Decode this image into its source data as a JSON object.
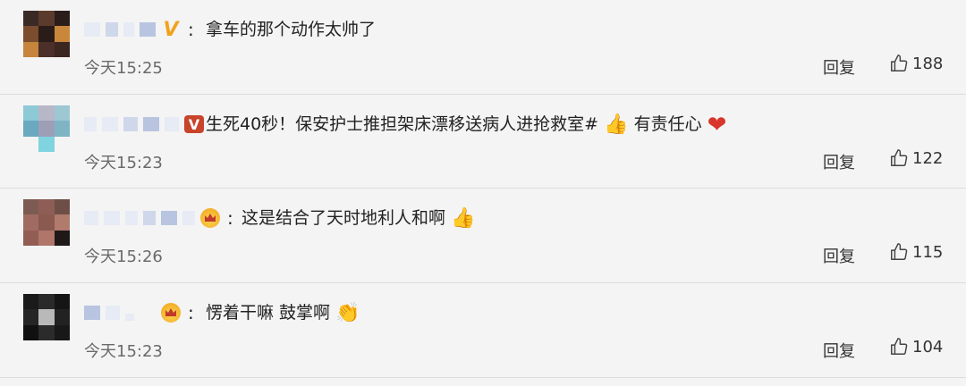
{
  "comments": [
    {
      "text_before": "拿车的那个动作太帅了",
      "text_after": "",
      "time": "今天15:25",
      "reply_label": "回复",
      "likes": "188"
    },
    {
      "text_before": "生死40秒！保安护士推担架床漂移送病人进抢救室#",
      "text_after": "有责任心",
      "time": "今天15:23",
      "reply_label": "回复",
      "likes": "122"
    },
    {
      "text_before": "这是结合了天时地利人和啊",
      "text_after": "",
      "time": "今天15:26",
      "reply_label": "回复",
      "likes": "115"
    },
    {
      "text_before": "愣着干嘛 鼓掌啊",
      "text_after": "",
      "time": "今天15:23",
      "reply_label": "回复",
      "likes": "104"
    }
  ],
  "colors": {
    "background": "#f4f4f4",
    "divider": "#dcdcdc",
    "verified_gold": "#f1a21d",
    "verified_red": "#c8442a",
    "heart": "#d8362b"
  }
}
